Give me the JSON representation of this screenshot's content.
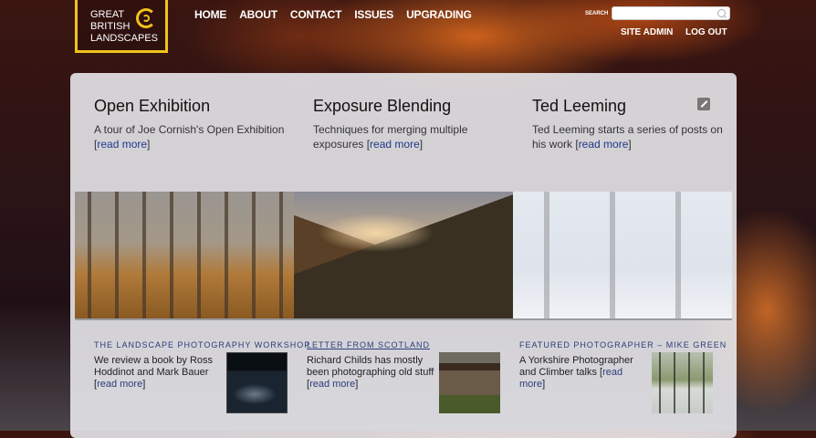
{
  "header": {
    "logo_lines": [
      "GREAT",
      "BRITISH",
      "LANDSCAPES"
    ],
    "nav": [
      "HOME",
      "ABOUT",
      "CONTACT",
      "ISSUES",
      "UPGRADING"
    ],
    "search_label": "SEARCH",
    "search_value": "",
    "site_admin": "SITE ADMIN",
    "log_out": "LOG OUT"
  },
  "features": [
    {
      "title": "Open Exhibition",
      "text": "A tour of Joe Cornish's Open Exhibition",
      "link": "read more"
    },
    {
      "title": "Exposure Blending",
      "text": "Techniques for merging multiple exposures",
      "link": "read more"
    },
    {
      "title": "Ted Leeming",
      "text": "Ted Leeming starts a series of posts on his work",
      "link": "read more"
    }
  ],
  "stories": [
    {
      "kicker": "THE LANDSCAPE PHOTOGRAPHY WORKSHOP",
      "text": "We review a book by Ross Hoddinot and Mark Bauer",
      "link": "read more"
    },
    {
      "kicker": "LETTER FROM SCOTLAND",
      "text": "Richard Childs has mostly been photographing old stuff",
      "link": "read more"
    },
    {
      "kicker": "FEATURED PHOTOGRAPHER – MIKE GREEN",
      "text": "A Yorkshire Photographer and Climber talks",
      "link": "read more"
    }
  ],
  "icons": {
    "edit": "edit-icon",
    "search": "search-icon",
    "logo": "spiral-logo-icon"
  },
  "colors": {
    "accent": "#f2c21a",
    "link": "#1f3a8a"
  }
}
